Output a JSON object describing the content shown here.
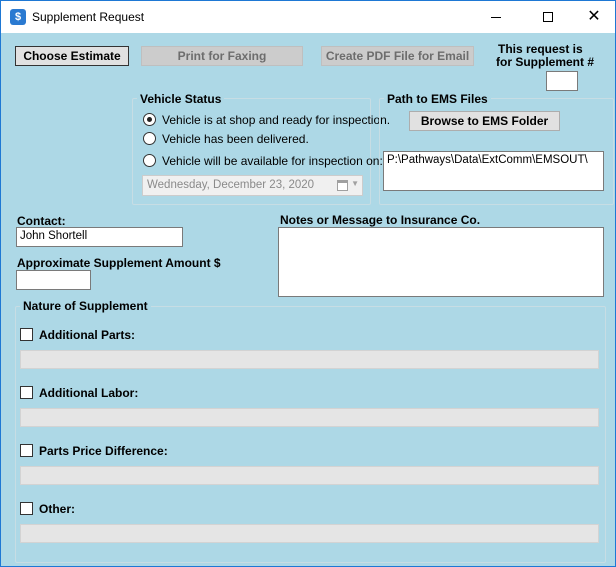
{
  "window": {
    "title": "Supplement Request"
  },
  "toolbar": {
    "choose_estimate": "Choose Estimate",
    "print_for_faxing": "Print for Faxing",
    "create_pdf": "Create PDF File for Email"
  },
  "supplement_number": {
    "label_line1": "This request is",
    "label_line2": "for Supplement #",
    "value": ""
  },
  "vehicle_status": {
    "title": "Vehicle Status",
    "options": [
      {
        "label": "Vehicle is at shop and ready for inspection.",
        "selected": true
      },
      {
        "label": "Vehicle has been delivered.",
        "selected": false
      },
      {
        "label": "Vehicle will be available for inspection on:",
        "selected": false
      }
    ],
    "date_value": "Wednesday, December 23, 2020"
  },
  "ems": {
    "title": "Path to EMS Files",
    "browse_label": "Browse to EMS Folder",
    "path_value": "P:\\Pathways\\Data\\ExtComm\\EMSOUT\\"
  },
  "contact": {
    "label": "Contact:",
    "value": "John Shortell"
  },
  "amount": {
    "label": "Approximate Supplement Amount $",
    "value": ""
  },
  "notes": {
    "label": "Notes or Message to Insurance Co.",
    "value": ""
  },
  "nature": {
    "title": "Nature of Supplement",
    "items": [
      {
        "label": "Additional Parts:",
        "checked": false,
        "detail": ""
      },
      {
        "label": "Additional Labor:",
        "checked": false,
        "detail": ""
      },
      {
        "label": "Parts Price Difference:",
        "checked": false,
        "detail": ""
      },
      {
        "label": "Other:",
        "checked": false,
        "detail": ""
      }
    ]
  }
}
